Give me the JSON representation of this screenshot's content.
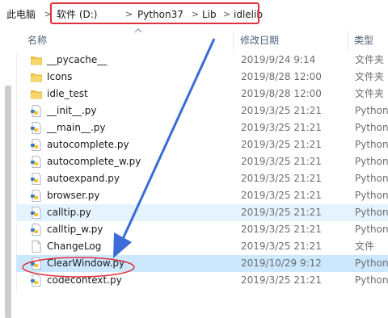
{
  "breadcrumb": {
    "root": "此电脑",
    "items": [
      "软件 (D:)",
      "Python37",
      "Lib",
      "idlelib"
    ],
    "separator": ">"
  },
  "columns": {
    "name": "名称",
    "date": "修改日期",
    "type": "类型"
  },
  "files": [
    {
      "name": "__pycache__",
      "date": "2019/9/24 9:14",
      "type": "文件夹",
      "icon": "folder-icon"
    },
    {
      "name": "Icons",
      "date": "2019/8/28 12:00",
      "type": "文件夹",
      "icon": "folder-icon"
    },
    {
      "name": "idle_test",
      "date": "2019/8/28 12:00",
      "type": "文件夹",
      "icon": "folder-icon"
    },
    {
      "name": "__init__.py",
      "date": "2019/3/25 21:21",
      "type": "Python",
      "icon": "python-file-icon"
    },
    {
      "name": "__main__.py",
      "date": "2019/3/25 21:21",
      "type": "Python",
      "icon": "python-file-icon"
    },
    {
      "name": "autocomplete.py",
      "date": "2019/3/25 21:21",
      "type": "Python",
      "icon": "python-file-icon"
    },
    {
      "name": "autocomplete_w.py",
      "date": "2019/3/25 21:21",
      "type": "Python",
      "icon": "python-file-icon"
    },
    {
      "name": "autoexpand.py",
      "date": "2019/3/25 21:21",
      "type": "Python",
      "icon": "python-file-icon"
    },
    {
      "name": "browser.py",
      "date": "2019/3/25 21:21",
      "type": "Python",
      "icon": "python-file-icon"
    },
    {
      "name": "calltip.py",
      "date": "2019/3/25 21:21",
      "type": "Python",
      "icon": "python-file-icon"
    },
    {
      "name": "calltip_w.py",
      "date": "2019/3/25 21:21",
      "type": "Python",
      "icon": "python-file-icon"
    },
    {
      "name": "ChangeLog",
      "date": "2019/3/25 21:21",
      "type": "文件",
      "icon": "generic-file-icon"
    },
    {
      "name": "ClearWindow.py",
      "date": "2019/10/29 9:12",
      "type": "Python",
      "icon": "python-file-icon"
    },
    {
      "name": "codecontext.py",
      "date": "2019/3/25 21:21",
      "type": "Python",
      "icon": "python-file-icon"
    }
  ],
  "state": {
    "hovered_file": "calltip.py",
    "selected_file": "ClearWindow.py"
  },
  "colors": {
    "annotation_red": "#e0303b",
    "annotation_arrow": "#3a6bd6",
    "selection": "#cce8ff",
    "hover": "#e5f3ff",
    "folder": "#f1c644",
    "header_text": "#4c607a"
  }
}
